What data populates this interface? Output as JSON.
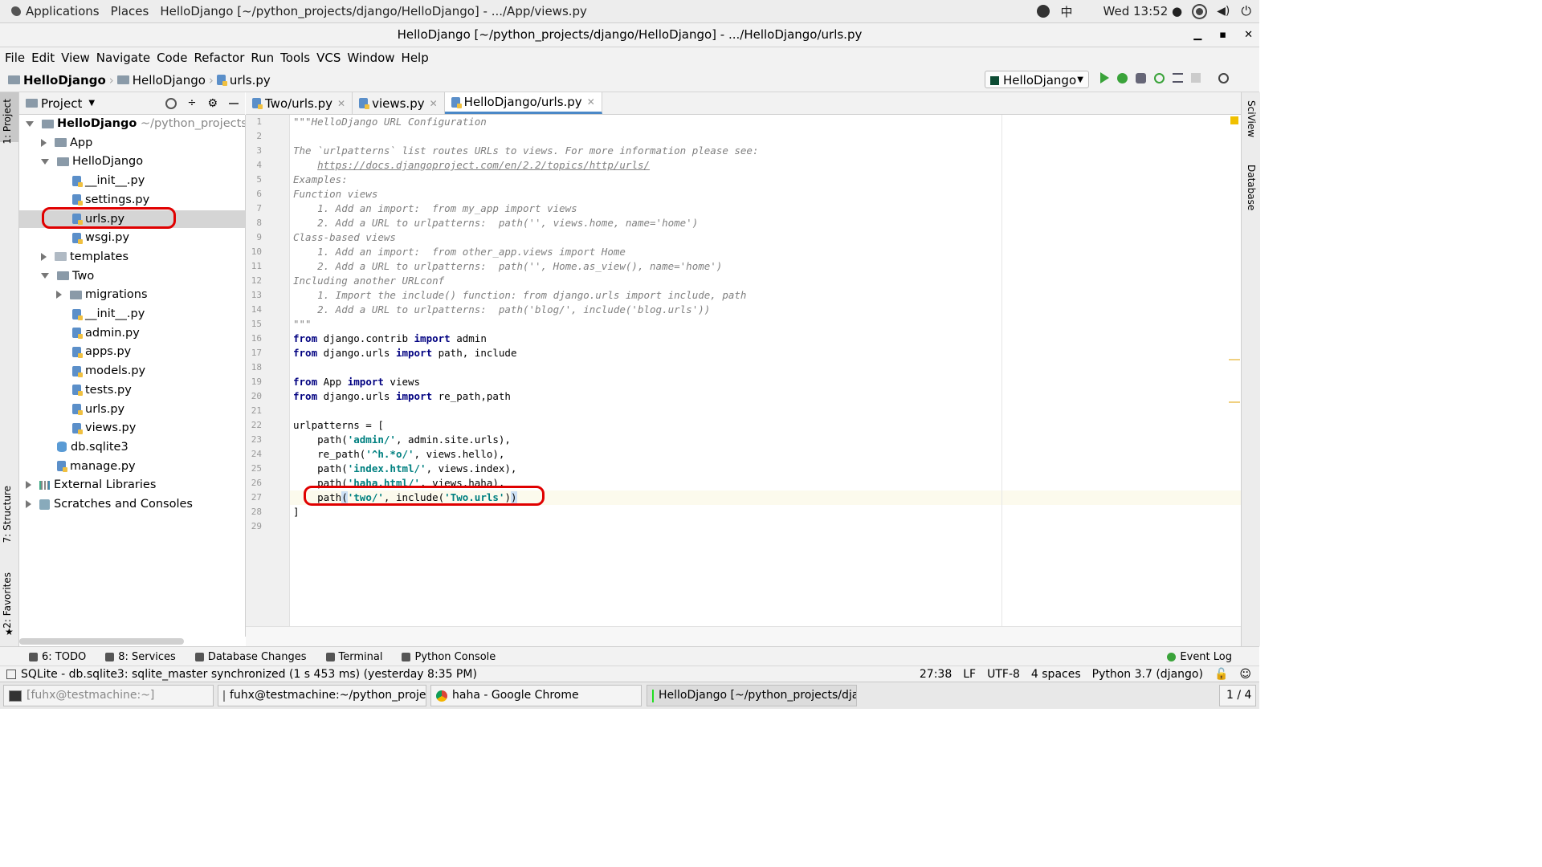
{
  "topbar": {
    "applications": "Applications",
    "places": "Places",
    "window_title": "HelloDjango [~/python_projects/django/HelloDjango] - .../App/views.py",
    "input_method": "中",
    "clock": "Wed 13:52 ●"
  },
  "window": {
    "title": "HelloDjango [~/python_projects/django/HelloDjango] - .../HelloDjango/urls.py"
  },
  "menu": [
    "File",
    "Edit",
    "View",
    "Navigate",
    "Code",
    "Refactor",
    "Run",
    "Tools",
    "VCS",
    "Window",
    "Help"
  ],
  "breadcrumb": [
    "HelloDjango",
    "HelloDjango",
    "urls.py"
  ],
  "run_config": "HelloDjango",
  "left_stripe": {
    "project": "1: Project",
    "structure": "7: Structure",
    "favorites": "2: Favorites"
  },
  "right_stripe": {
    "sciview": "SciView",
    "database": "Database"
  },
  "project_panel": {
    "title": "Project"
  },
  "tree": [
    {
      "label": "HelloDjango",
      "extra": "~/python_projects/djan",
      "indent": 0,
      "arrow": "d",
      "icon": "folder",
      "bold": true
    },
    {
      "label": "App",
      "indent": 1,
      "arrow": "r",
      "icon": "folder"
    },
    {
      "label": "HelloDjango",
      "indent": 1,
      "arrow": "d",
      "icon": "folder"
    },
    {
      "label": "__init__.py",
      "indent": 2,
      "icon": "py"
    },
    {
      "label": "settings.py",
      "indent": 2,
      "icon": "py"
    },
    {
      "label": "urls.py",
      "indent": 2,
      "icon": "py",
      "selected": true
    },
    {
      "label": "wsgi.py",
      "indent": 2,
      "icon": "py"
    },
    {
      "label": "templates",
      "indent": 1,
      "arrow": "r",
      "icon": "folder-light"
    },
    {
      "label": "Two",
      "indent": 1,
      "arrow": "d",
      "icon": "folder"
    },
    {
      "label": "migrations",
      "indent": 2,
      "arrow": "r",
      "icon": "folder"
    },
    {
      "label": "__init__.py",
      "indent": 2,
      "icon": "py"
    },
    {
      "label": "admin.py",
      "indent": 2,
      "icon": "py"
    },
    {
      "label": "apps.py",
      "indent": 2,
      "icon": "py"
    },
    {
      "label": "models.py",
      "indent": 2,
      "icon": "py"
    },
    {
      "label": "tests.py",
      "indent": 2,
      "icon": "py"
    },
    {
      "label": "urls.py",
      "indent": 2,
      "icon": "py"
    },
    {
      "label": "views.py",
      "indent": 2,
      "icon": "py"
    },
    {
      "label": "db.sqlite3",
      "indent": 1,
      "icon": "db"
    },
    {
      "label": "manage.py",
      "indent": 1,
      "icon": "py"
    },
    {
      "label": "External Libraries",
      "indent": 0,
      "arrow": "r",
      "icon": "lib"
    },
    {
      "label": "Scratches and Consoles",
      "indent": 0,
      "arrow": "r",
      "icon": "scratch"
    }
  ],
  "tabs": [
    {
      "label": "Two/urls.py",
      "active": false
    },
    {
      "label": "views.py",
      "active": false
    },
    {
      "label": "HelloDjango/urls.py",
      "active": true
    }
  ],
  "code_lines": [
    "\"\"\"HelloDjango URL Configuration",
    "",
    "The `urlpatterns` list routes URLs to views. For more information please see:",
    "    https://docs.djangoproject.com/en/2.2/topics/http/urls/",
    "Examples:",
    "Function views",
    "    1. Add an import:  from my_app import views",
    "    2. Add a URL to urlpatterns:  path('', views.home, name='home')",
    "Class-based views",
    "    1. Add an import:  from other_app.views import Home",
    "    2. Add a URL to urlpatterns:  path('', Home.as_view(), name='home')",
    "Including another URLconf",
    "    1. Import the include() function: from django.urls import include, path",
    "    2. Add a URL to urlpatterns:  path('blog/', include('blog.urls'))",
    "\"\"\"",
    "from django.contrib import admin",
    "from django.urls import path, include",
    "",
    "from App import views",
    "from django.urls import re_path,path",
    "",
    "urlpatterns = [",
    "    path('admin/', admin.site.urls),",
    "    re_path('^h.*o/', views.hello),",
    "    path('index.html/', views.index),",
    "    path('haha.html/', views.haha),",
    "    path('two/', include('Two.urls'))",
    "]",
    ""
  ],
  "current_line": 27,
  "toolwindows": [
    {
      "label": "6: TODO"
    },
    {
      "label": "8: Services"
    },
    {
      "label": "Database Changes"
    },
    {
      "label": "Terminal"
    },
    {
      "label": "Python Console"
    }
  ],
  "event_log": "Event Log",
  "status": {
    "message": "SQLite - db.sqlite3: sqlite_master synchronized (1 s 453 ms) (yesterday 8:35 PM)",
    "position": "27:38",
    "line_sep": "LF",
    "encoding": "UTF-8",
    "indent": "4 spaces",
    "interpreter": "Python 3.7 (django)"
  },
  "taskbar": [
    {
      "label": "[fuhx@testmachine:~]",
      "dim": true
    },
    {
      "label": "fuhx@testmachine:~/python_project..."
    },
    {
      "label": "haha - Google Chrome"
    },
    {
      "label": "HelloDjango [~/python_projects/djan...",
      "active": true
    }
  ],
  "workspace": "1 / 4",
  "colors": {
    "highlight": "#e00000",
    "accent": "#4a88c7",
    "keyword": "#000080",
    "string": "#008080"
  }
}
